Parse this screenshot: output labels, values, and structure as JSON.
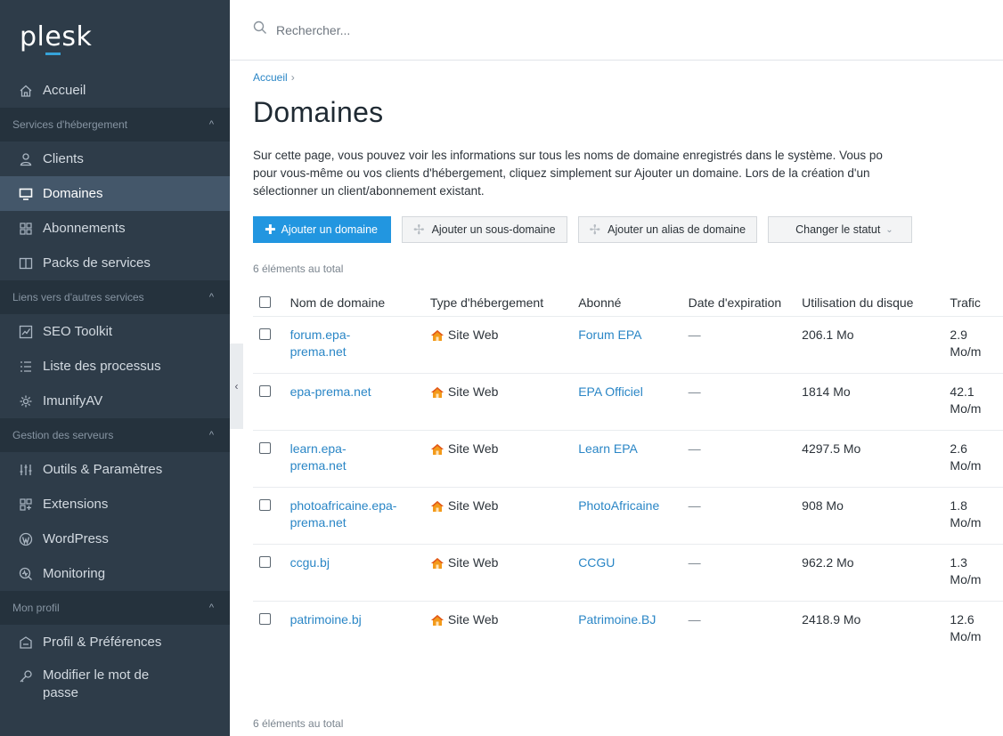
{
  "app": {
    "logo": "plesk"
  },
  "search": {
    "placeholder": "Rechercher..."
  },
  "sidebar": {
    "accueil": "Accueil",
    "section_hebergement": "Services d'hébergement",
    "clients": "Clients",
    "domaines": "Domaines",
    "abonnements": "Abonnements",
    "packs": "Packs de services",
    "section_liens": "Liens vers d'autres services",
    "seo": "SEO Toolkit",
    "processus": "Liste des processus",
    "imunify": "ImunifyAV",
    "section_gestion": "Gestion des serveurs",
    "outils": "Outils & Paramètres",
    "extensions": "Extensions",
    "wordpress": "WordPress",
    "monitoring": "Monitoring",
    "section_profil": "Mon profil",
    "profil": "Profil & Préférences",
    "mdp": "Modifier le mot de passe"
  },
  "page": {
    "breadcrumb": "Accueil",
    "title": "Domaines",
    "desc_line1": "Sur cette page, vous pouvez voir les informations sur tous les noms de domaine enregistrés dans le système. Vous po",
    "desc_line2": "pour vous-même ou vos clients d'hébergement, cliquez simplement sur Ajouter un domaine. Lors de la création d'un",
    "desc_line3": "sélectionner un client/abonnement existant.",
    "total_top": "6 éléments au total",
    "total_bottom": "6 éléments au total"
  },
  "toolbar": {
    "add_domain": "Ajouter un domaine",
    "add_subdomain": "Ajouter un sous-domaine",
    "add_alias": "Ajouter un alias de domaine",
    "change_status": "Changer le statut"
  },
  "table": {
    "columns": [
      "Nom de domaine",
      "Type d'hébergement",
      "Abonné",
      "Date d'expiration",
      "Utilisation du disque",
      "Trafic"
    ],
    "rows": [
      {
        "domain1": "forum.epa-",
        "domain2": "prema.net",
        "type": "Site Web",
        "subscriber": "Forum EPA",
        "expiry": "—",
        "disk": "206.1 Mo",
        "traffic1": "2.9",
        "traffic2": "Mo/m"
      },
      {
        "domain1": "epa-prema.net",
        "domain2": "",
        "type": "Site Web",
        "subscriber": "EPA Officiel",
        "expiry": "—",
        "disk": "1814 Mo",
        "traffic1": "42.1",
        "traffic2": "Mo/m"
      },
      {
        "domain1": "learn.epa-",
        "domain2": "prema.net",
        "type": "Site Web",
        "subscriber": "Learn EPA",
        "expiry": "—",
        "disk": "4297.5 Mo",
        "traffic1": "2.6",
        "traffic2": "Mo/m"
      },
      {
        "domain1": "photoafricaine.epa-",
        "domain2": "prema.net",
        "type": "Site Web",
        "subscriber": "PhotoAfricaine",
        "expiry": "—",
        "disk": "908 Mo",
        "traffic1": "1.8",
        "traffic2": "Mo/m"
      },
      {
        "domain1": "ccgu.bj",
        "domain2": "",
        "type": "Site Web",
        "subscriber": "CCGU",
        "expiry": "—",
        "disk": "962.2 Mo",
        "traffic1": "1.3",
        "traffic2": "Mo/m"
      },
      {
        "domain1": "patrimoine.bj",
        "domain2": "",
        "type": "Site Web",
        "subscriber": "Patrimoine.BJ",
        "expiry": "—",
        "disk": "2418.9 Mo",
        "traffic1": "12.6",
        "traffic2": "Mo/m"
      }
    ]
  }
}
